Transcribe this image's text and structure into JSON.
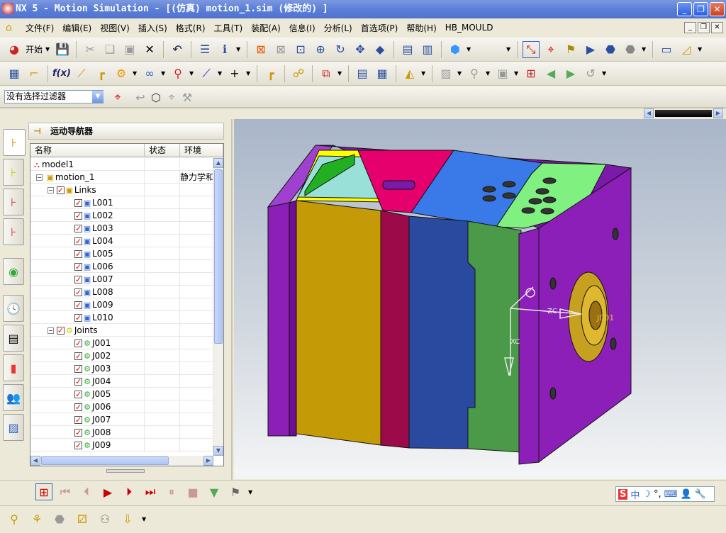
{
  "window": {
    "title": "NX 5 - Motion Simulation - [(仿真) motion_1.sim (修改的) ]",
    "controls": [
      "minimize",
      "restore",
      "close"
    ]
  },
  "menu": {
    "items": [
      "文件(F)",
      "编辑(E)",
      "视图(V)",
      "插入(S)",
      "格式(R)",
      "工具(T)",
      "装配(A)",
      "信息(I)",
      "分析(L)",
      "首选项(P)",
      "帮助(H)",
      "HB_MOULD"
    ]
  },
  "toolbar": {
    "start_label": "开始"
  },
  "filter": {
    "value": "没有选择过滤器"
  },
  "navigator": {
    "title": "运动导航器",
    "columns": [
      "名称",
      "状态",
      "环境"
    ],
    "rows": [
      {
        "name": "model1",
        "level": 0,
        "icon": "assembly-tree-icon",
        "status": "",
        "env": ""
      },
      {
        "name": "motion_1",
        "level": 1,
        "icon": "motion-sim-icon",
        "status": "",
        "env": "静力学和"
      },
      {
        "name": "Links",
        "level": 2,
        "icon": "links-folder-icon",
        "checked": true,
        "status": "",
        "env": ""
      },
      {
        "name": "L001",
        "level": 3,
        "icon": "link-icon",
        "checked": true
      },
      {
        "name": "L002",
        "level": 3,
        "icon": "link-icon",
        "checked": true
      },
      {
        "name": "L003",
        "level": 3,
        "icon": "link-icon",
        "checked": true
      },
      {
        "name": "L004",
        "level": 3,
        "icon": "link-icon",
        "checked": true
      },
      {
        "name": "L005",
        "level": 3,
        "icon": "link-icon",
        "checked": true
      },
      {
        "name": "L006",
        "level": 3,
        "icon": "link-icon",
        "checked": true
      },
      {
        "name": "L007",
        "level": 3,
        "icon": "link-icon",
        "checked": true
      },
      {
        "name": "L008",
        "level": 3,
        "icon": "link-icon",
        "checked": true
      },
      {
        "name": "L009",
        "level": 3,
        "icon": "link-icon",
        "checked": true
      },
      {
        "name": "L010",
        "level": 3,
        "icon": "link-icon",
        "checked": true
      },
      {
        "name": "Joints",
        "level": 2,
        "icon": "joints-folder-icon",
        "checked": true
      },
      {
        "name": "J001",
        "level": 3,
        "icon": "joint-icon",
        "checked": true
      },
      {
        "name": "J002",
        "level": 3,
        "icon": "joint-icon",
        "checked": true
      },
      {
        "name": "J003",
        "level": 3,
        "icon": "joint-icon",
        "checked": true
      },
      {
        "name": "J004",
        "level": 3,
        "icon": "joint-icon",
        "checked": true
      },
      {
        "name": "J005",
        "level": 3,
        "icon": "joint-icon",
        "checked": true
      },
      {
        "name": "J006",
        "level": 3,
        "icon": "joint-icon",
        "checked": true
      },
      {
        "name": "J007",
        "level": 3,
        "icon": "joint-icon",
        "checked": true
      },
      {
        "name": "J008",
        "level": 3,
        "icon": "joint-icon",
        "checked": true
      },
      {
        "name": "J009",
        "level": 3,
        "icon": "joint-icon",
        "checked": true
      }
    ]
  },
  "viewport": {
    "axis_labels": {
      "zc": "ZC",
      "xc": "XC"
    },
    "joint_label": "J001"
  },
  "ime": {
    "label": "中"
  },
  "colors": {
    "purple": "#8b1fb8",
    "olive": "#c49a06",
    "crimson": "#9c0a4a",
    "blue": "#2a4aa0",
    "green": "#4a9a4a",
    "yellow": "#ffff00",
    "pink": "#e6006e",
    "lightblue": "#3a7ae8",
    "lightgreen": "#80f080"
  }
}
